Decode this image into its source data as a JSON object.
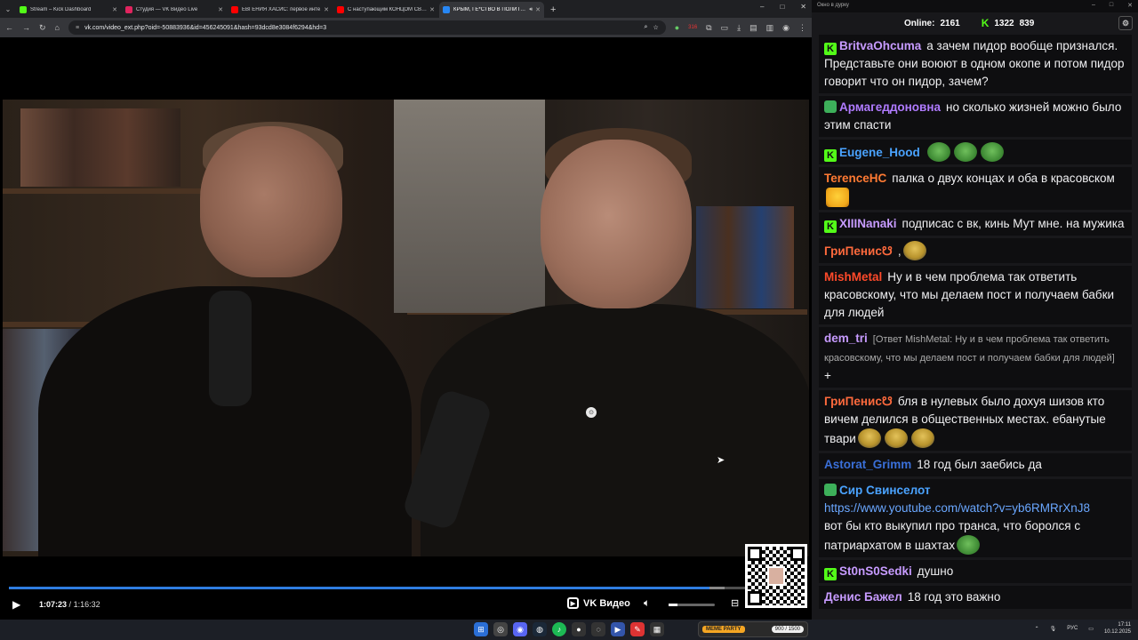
{
  "browser": {
    "tabs": [
      {
        "label": "Stream – Kick Dashboard",
        "color": "#53fc18",
        "active": false
      },
      {
        "label": "Студия — VK Видео Live",
        "color": "#e0245e",
        "active": false
      },
      {
        "label": "ЕВГЕНИЯ ХАСИС: первое инте…",
        "color": "#ff0000",
        "active": false
      },
      {
        "label": "С наступающим КОНЦОМ СВ…",
        "color": "#ff0000",
        "active": false
      },
      {
        "label": "КРЫМ, ГЕ*СТВО В ПОЛИТ…",
        "color": "#2787f5",
        "active": true
      }
    ],
    "url": "vk.com/video_ext.php?oid=-50883936&id=456245091&hash=93dcd8e3084f6294&hd=3",
    "ext_badge": "316"
  },
  "player": {
    "current_time": "1:07:23",
    "separator": "/",
    "total_time": "1:16:32",
    "progress": 0.88,
    "buffered": 0.9,
    "volume": 0.2,
    "brand": "VK Видео"
  },
  "chat": {
    "window_title": "Окно в дурку",
    "online_label": "Online:",
    "online_count": "2161",
    "kick_count": "1322",
    "sub_count": "839",
    "messages": [
      {
        "user": "BritvaOhcuma",
        "color": "#c79bff",
        "badges": [
          "kick"
        ],
        "text": "а зачем пидор вообще признался. Представьте они воюют в одном окопе и потом пидор говорит что он пидор, зачем?"
      },
      {
        "user": "Армагеддоновна",
        "color": "#b07bff",
        "badges": [
          "mod",
          "sub"
        ],
        "text": "но сколько жизней можно было этим спасти"
      },
      {
        "user": "Eugene_Hood",
        "color": "#4aa3ff",
        "badges": [
          "kick"
        ],
        "text": "",
        "emotes": [
          "pepe",
          "pepe",
          "pepe"
        ]
      },
      {
        "user": "TerenceHC",
        "color": "#ff7a33",
        "badges": [
          "sub"
        ],
        "text": "палка о двух концах и оба в красовском",
        "emotes": [
          "lol"
        ]
      },
      {
        "user": "XIIINanaki",
        "color": "#c79bff",
        "badges": [
          "kick"
        ],
        "text": "подписас с вк, кинь Мут мне. на мужика"
      },
      {
        "user": "ГриПенис☋",
        "color": "#ff6a3d",
        "badges": [
          "sub"
        ],
        "text": ",",
        "emotes": [
          "bald"
        ]
      },
      {
        "user": "MishMetal",
        "color": "#ff4a2a",
        "badges": [
          "sub"
        ],
        "text": "Ну и в чем проблема так ответить красовскому, что мы делаем пост и получаем бабки для людей"
      },
      {
        "user": "dem_tri",
        "color": "#c79bff",
        "badges": [
          "sub"
        ],
        "reply": "[Ответ MishMetal: Ну и в чем проблема так ответить красовскому, что мы делаем пост и получаем бабки для людей]",
        "text": "+"
      },
      {
        "user": "ГриПенис☋",
        "color": "#ff6a3d",
        "badges": [
          "sub"
        ],
        "text": "бля в нулевых было дохуя шизов кто вичем делился в общественных местах. ебанутые твари",
        "emotes": [
          "bald",
          "bald",
          "bald"
        ]
      },
      {
        "user": "Astorat_Grimm",
        "color": "#3a6fd8",
        "badges": [
          "sub"
        ],
        "text": "18 год был заебись да"
      },
      {
        "user": "Сир Свинселот",
        "color": "#4aa3ff",
        "badges": [
          "mod",
          "sub"
        ],
        "link": "https://www.youtube.com/watch?v=yb6RMRrXnJ8",
        "text": "вот бы кто выкупил про транса, что боролся с патриархатом в шахтах",
        "emotes": [
          "pepe"
        ]
      },
      {
        "user": "St0nS0Sedki",
        "color": "#c79bff",
        "badges": [
          "kick"
        ],
        "text": "душно"
      },
      {
        "user": "Денис Бажел",
        "color": "#c79bff",
        "badges": [
          "sub"
        ],
        "text": "18 год это важно"
      }
    ]
  },
  "taskbar": {
    "meme_party_label": "MEME PARTY",
    "meme_party_progress": "900 / 1500",
    "lang": "РУС",
    "time": "17:11",
    "date": "10.12.2025"
  }
}
